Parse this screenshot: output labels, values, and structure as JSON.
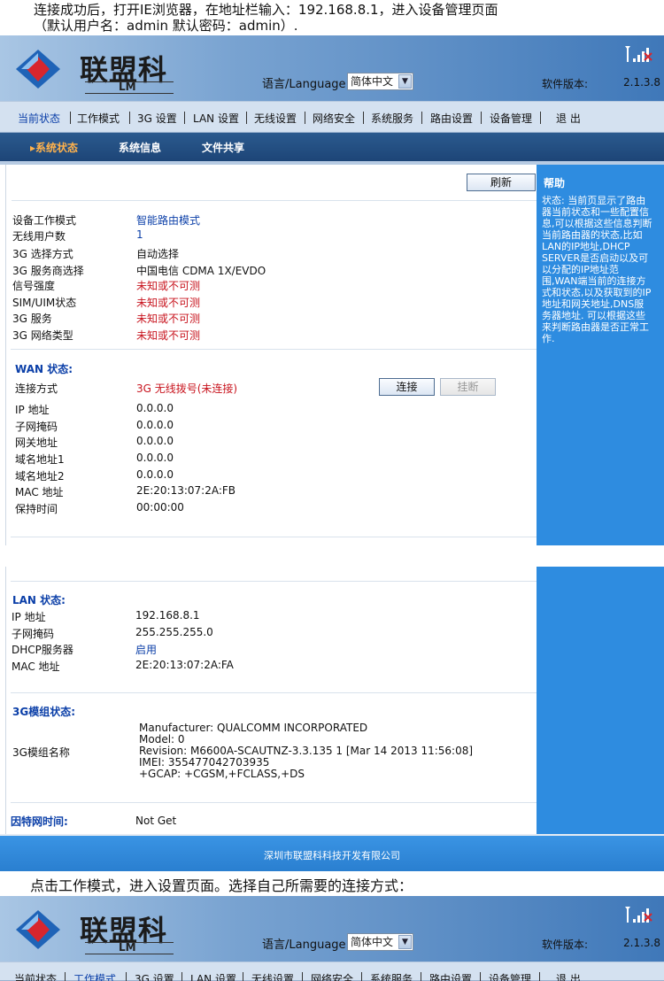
{
  "intro": {
    "line1": "连接成功后，打开IE浏览器，在地址栏输入：192.168.8.1，进入设备管理页面",
    "line2": "（默认用户名：admin 默认密码：admin）."
  },
  "header": {
    "logo_text": "联盟科",
    "logo_sub": "LM",
    "language_label": "语言/Language:",
    "language_value": "简体中文",
    "version_label": "软件版本:",
    "version_value": "2.1.3.8"
  },
  "nav": {
    "items": [
      "当前状态",
      "工作模式",
      "3G 设置",
      "LAN 设置",
      "无线设置",
      "网络安全",
      "系统服务",
      "路由设置",
      "设备管理",
      "退 出"
    ]
  },
  "subnav": {
    "items": [
      "系统状态",
      "系统信息",
      "文件共享"
    ]
  },
  "status": {
    "refresh_button": "刷新",
    "rows": [
      {
        "label": "设备工作模式",
        "value": "智能路由模式"
      },
      {
        "label": "无线用户数",
        "value": "1"
      },
      {
        "label": "3G 选择方式",
        "value": "自动选择"
      },
      {
        "label": "3G 服务商选择",
        "value": "中国电信  CDMA 1X/EVDO"
      },
      {
        "label": "信号强度",
        "value": "未知或不可测"
      },
      {
        "label": "SIM/UIM状态",
        "value": "未知或不可测"
      },
      {
        "label": "3G 服务",
        "value": "未知或不可测"
      },
      {
        "label": "3G 网络类型",
        "value": "未知或不可测"
      }
    ]
  },
  "wan": {
    "title": "WAN 状态:",
    "connect_label": "连接方式",
    "connect_value": "3G 无线拨号(未连接)",
    "connect_button": "连接",
    "disconnect_button": "挂断",
    "rows": [
      {
        "label": "IP 地址",
        "value": "0.0.0.0"
      },
      {
        "label": "子网掩码",
        "value": "0.0.0.0"
      },
      {
        "label": "网关地址",
        "value": "0.0.0.0"
      },
      {
        "label": "域名地址1",
        "value": "0.0.0.0"
      },
      {
        "label": "域名地址2",
        "value": "0.0.0.0"
      },
      {
        "label": "MAC 地址",
        "value": "2E:20:13:07:2A:FB"
      },
      {
        "label": "保持时间",
        "value": "00:00:00"
      }
    ]
  },
  "help": {
    "title": "帮助",
    "text": "状态: 当前页显示了路由器当前状态和一些配置信息,可以根据这些信息判断当前路由器的状态,比如LAN的IP地址,DHCP SERVER是否启动以及可以分配的IP地址范围,WAN端当前的连接方式和状态,以及获取到的IP地址和网关地址,DNS服务器地址. 可以根据这些来判断路由器是否正常工作."
  },
  "lan": {
    "title": "LAN 状态:",
    "rows": [
      {
        "label": "IP 地址",
        "value": "192.168.8.1"
      },
      {
        "label": "子网掩码",
        "value": "255.255.255.0"
      },
      {
        "label": "DHCP服务器",
        "value": "启用"
      },
      {
        "label": "MAC 地址",
        "value": "2E:20:13:07:2A:FA"
      }
    ]
  },
  "module": {
    "title": "3G模组状态:",
    "label": "3G模组名称",
    "lines": [
      "Manufacturer: QUALCOMM INCORPORATED",
      "Model: 0",
      "Revision: M6600A-SCAUTNZ-3.3.135 1 [Mar 14 2013 11:56:08]",
      "IMEI: 355477042703935",
      "+GCAP: +CGSM,+FCLASS,+DS"
    ]
  },
  "internet": {
    "label": "因特网时间:",
    "value": "Not Get"
  },
  "footer": {
    "text": "深圳市联盟科科技开发有限公司"
  },
  "mid_text": "点击工作模式，进入设置页面。选择自己所需要的连接方式："
}
